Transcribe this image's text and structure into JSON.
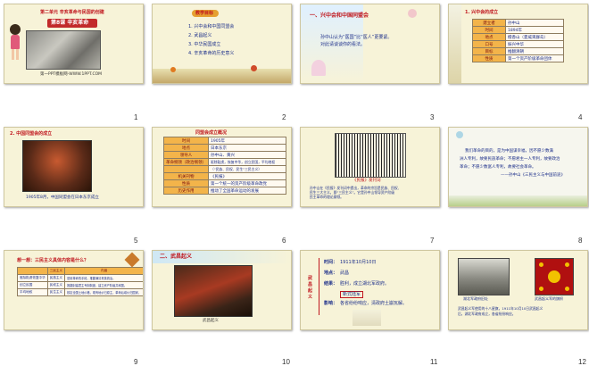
{
  "slides": [
    {
      "number": "1",
      "unit": "第二单元  辛亥革命与民国的创建",
      "lesson_badge": "第8课  辛亥革命",
      "footer": "第一PPT模板网-WWW.1PPT.COM"
    },
    {
      "number": "2",
      "heading": "教学目标",
      "items": [
        "1. 兴中会和中国同盟会",
        "2. 武昌起义",
        "3. 中华民国成立",
        "4. 辛亥革命的历史意义"
      ]
    },
    {
      "number": "3",
      "title": "一、兴中会和中国同盟会",
      "lines": [
        "孙中山认为“医国”比“医人”更要紧。",
        "对此请谈谈你的看法。"
      ]
    },
    {
      "number": "4",
      "title": "1. 兴中会的成立",
      "rows": [
        {
          "k": "建立者",
          "v": "孙中山"
        },
        {
          "k": "时间",
          "v": "1894年"
        },
        {
          "k": "地点",
          "v": "檀香山（夏威夷群岛）"
        },
        {
          "k": "口号",
          "v": "振兴中华"
        },
        {
          "k": "目标",
          "v": "推翻清朝"
        },
        {
          "k": "性质",
          "v": "第一个资产阶级革命团体"
        }
      ]
    },
    {
      "number": "5",
      "title": "2. 中国同盟会的成立",
      "caption": "1905年8月，中国同盟会在日本东京成立"
    },
    {
      "number": "6",
      "title": "同盟会成立概况",
      "rows": [
        {
          "k": "时间",
          "v": "1905年"
        },
        {
          "k": "地点",
          "v": "日本东京"
        },
        {
          "k": "领导人",
          "v": "孙中山、黄兴"
        },
        {
          "k": "革命纲领（政治纲领）",
          "v": "驱除鞑虏，恢复中华，创立民国，平均地权"
        },
        {
          "k": "",
          "v": "（“民族、民权、民生”三民主义）"
        },
        {
          "k": "机关刊物",
          "v": "《民报》"
        },
        {
          "k": "性质",
          "v": "第一个统一的资产阶级革命政党"
        },
        {
          "k": "历史作用",
          "v": "推动了全国革命运动的发展"
        }
      ]
    },
    {
      "number": "7",
      "caption": "《民报》发刊词",
      "lines": [
        "孙中山在《民报》发刊词中提出，革命的宗旨是民族、民权、",
        "民生三大主义，即“三民主义”。它是孙中山领导资产阶级",
        "民主革命的理论纲领。"
      ]
    },
    {
      "number": "8",
      "lines": [
        "我们革命的目的，是为中国谋幸福，因不愿少数满",
        "洲人专利，故要民族革命；不愿君主一人专利，故要政治",
        "革命；不愿少数富人专利，故要社会革命。"
      ],
      "source": "——孙中山《三民主义与中国前途》"
    },
    {
      "number": "9",
      "question": "想一想：三民主义具体内容是什么？",
      "headers": [
        "三民主义",
        "内涵"
      ],
      "rows": [
        {
          "a": "驱除鞑虏恢复中华",
          "b": "民族主义",
          "c": "是用革命的手段，推翻满清贵族统治。"
        },
        {
          "a": "创立民国",
          "b": "民权主义",
          "c": "推翻封建君主专制制度，建立资产阶级共和国。"
        },
        {
          "a": "平均地权",
          "b": "民生主义",
          "c": "核定全国土地价格，现有地价归原主，革命后增价归国家。"
        }
      ]
    },
    {
      "number": "10",
      "title": "二、武昌起义",
      "caption": "武昌起义"
    },
    {
      "number": "11",
      "side": "武昌起义",
      "rows": [
        {
          "k": "时间：",
          "v": "1911年10月10日"
        },
        {
          "k": "地点：",
          "v": "武昌"
        },
        {
          "k": "结果：",
          "v": "胜利，成立湖北军政府。"
        },
        {
          "k": "",
          "v": "新式陆军"
        },
        {
          "k": "影响：",
          "v": "各省纷纷响应，清政府土崩瓦解。"
        }
      ]
    },
    {
      "number": "12",
      "cap_left": "湖北军政府旧址",
      "cap_right": "武昌起义军的旗帜",
      "lines": [
        "武昌起义军使用的十八星旗，1911年10月10日武昌起义",
        "后，湖北军政府成立，各省纷纷响应。"
      ]
    }
  ]
}
